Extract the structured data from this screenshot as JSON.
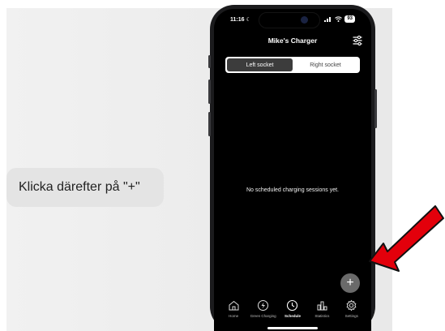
{
  "caption": {
    "text": "Klicka därefter på \"+\""
  },
  "status_bar": {
    "time": "11:16",
    "battery": "93"
  },
  "header": {
    "title": "Mike's Charger",
    "settings_icon": "sliders-icon"
  },
  "socket_selector": {
    "options": [
      "Left socket",
      "Right socket"
    ],
    "selected": "Left socket"
  },
  "main": {
    "empty_message": "No scheduled charging sessions yet."
  },
  "fab": {
    "label": "+",
    "icon": "plus-icon"
  },
  "tabbar": {
    "items": [
      {
        "label": "Home",
        "icon": "home-icon"
      },
      {
        "label": "Green Charging",
        "icon": "green-charging-icon"
      },
      {
        "label": "Schedule",
        "icon": "clock-icon",
        "active": true
      },
      {
        "label": "Statistics",
        "icon": "statistics-icon"
      },
      {
        "label": "Settings",
        "icon": "gear-icon"
      }
    ]
  },
  "colors": {
    "screen_background": "#000000",
    "annotation_arrow": "#e3000b",
    "active_segment": "#3c3c3c",
    "fab_background": "#6a6a6a"
  }
}
